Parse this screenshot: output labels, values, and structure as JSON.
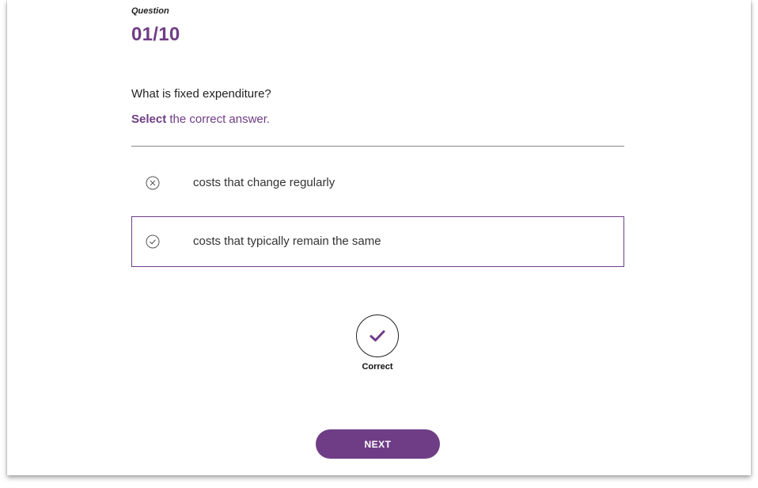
{
  "question": {
    "caption": "Question",
    "counter": "01/10",
    "text": "What is fixed expenditure?"
  },
  "instruction": {
    "strong": "Select",
    "rest": " the correct answer."
  },
  "options": [
    {
      "label": "costs that change regularly",
      "icon": "x-circle-icon",
      "state": "incorrect"
    },
    {
      "label": "costs that typically remain the same",
      "icon": "check-circle-icon",
      "state": "correct-selected"
    }
  ],
  "feedback": {
    "icon": "checkmark-icon",
    "label": "Correct"
  },
  "next_button": {
    "label": "NEXT"
  },
  "colors": {
    "accent": "#6f3d86",
    "text": "#222222",
    "divider": "#888888"
  }
}
